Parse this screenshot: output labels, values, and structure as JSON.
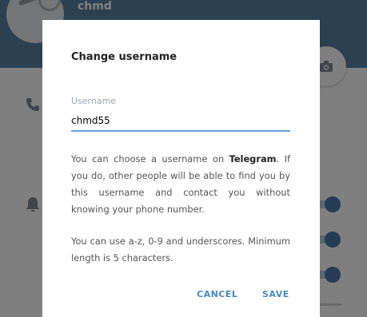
{
  "background": {
    "profile_name": "chmd",
    "icons": [
      "avatar",
      "camera-icon",
      "phone-icon",
      "bell-icon"
    ]
  },
  "dialog": {
    "title": "Change username",
    "field_label": "Username",
    "username_value": "chmd55",
    "paragraph1_before": "You can choose a username on ",
    "paragraph1_bold": "Telegram",
    "paragraph1_after": ". If you do, other people will be able to find you by this username and contact you without knowing your phone number.",
    "paragraph2": "You can use a-z, 0-9 and underscores. Minimum length is 5 characters.",
    "cancel_label": "CANCEL",
    "save_label": "SAVE"
  },
  "colors": {
    "header": "#5682a3",
    "accent": "#4a87c2",
    "input_underline": "#62a1d6"
  }
}
